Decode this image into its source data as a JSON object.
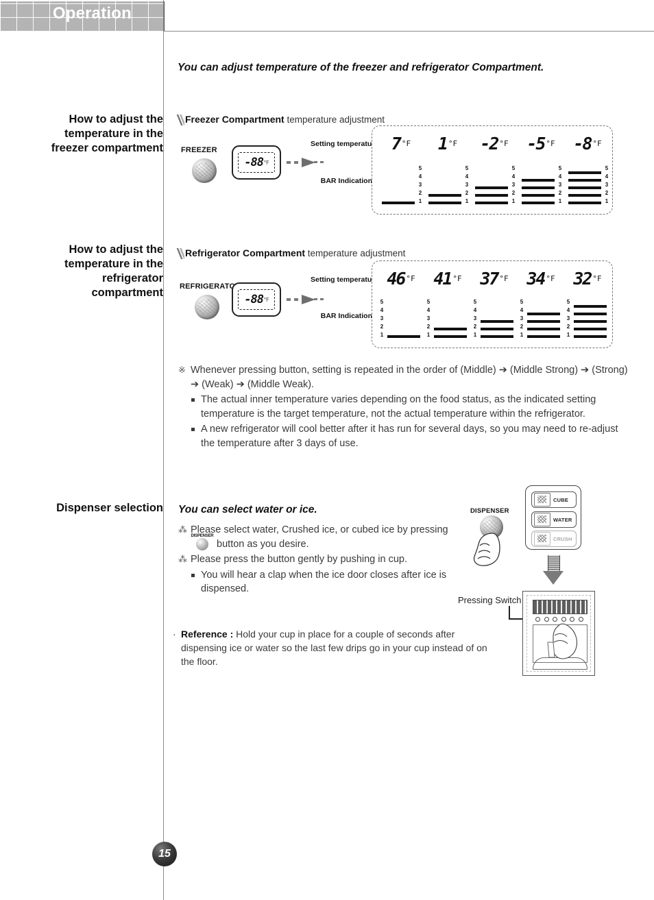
{
  "header": {
    "tab_title": "Operation"
  },
  "sidebar": {
    "headings": [
      {
        "id": "freezer",
        "text": "How to adjust the temperature in the freezer compartment"
      },
      {
        "id": "refrigerator",
        "text": "How to adjust the temperature in the refrigerator compartment"
      },
      {
        "id": "dispenser",
        "text": "Dispenser selection"
      }
    ]
  },
  "main": {
    "lead": "You can adjust temperature of the freezer and refrigerator Compartment.",
    "freezer_section": {
      "caption_bold": "Freezer Compartment",
      "caption_rest": " temperature adjustment",
      "knob_label": "FREEZER",
      "display_value": "-88",
      "display_unit": "°F",
      "label_setting": "Setting temperature",
      "label_bar": "BAR Indication"
    },
    "refrigerator_section": {
      "caption_bold": "Refrigerator Compartment",
      "caption_rest": " temperature adjustment",
      "knob_label": "REFRIGERATOR",
      "display_value": "-88",
      "display_unit": "°F",
      "label_setting": "Setting temperature",
      "label_bar": "BAR Indication"
    },
    "notes": [
      {
        "marker": "※",
        "text": "Whenever pressing button, setting is repeated in the order of (Middle) ➔ (Middle Strong) ➔  (Strong) ➔  (Weak) ➔  (Middle Weak)."
      }
    ],
    "sub_notes": [
      "The actual inner temperature varies depending on the food status, as the indicated setting temperature is the target temperature, not the actual temperature within the refrigerator.",
      "A new refrigerator will cool better after it has run for several days, so you may need to re-adjust the temperature after 3 days of use."
    ],
    "dispenser_section": {
      "title": "You can select water or ice.",
      "note1_part1": "Please select water, Crushed ice, or cubed ice by pressing",
      "note1_button_caption": "DISPENSER",
      "note1_part2": "button as you desire.",
      "note2": "Please press the button gently by pushing in cup.",
      "sub_note": "You will hear a clap when the ice door closes after ice is dispensed.",
      "reference_label": "Reference :",
      "reference_text": "Hold your cup in place for a couple of seconds after dispensing ice or water so the last few drips go in your cup instead of on the floor.",
      "illustration": {
        "dispenser_label": "DISPENSER",
        "buttons": [
          "CUBE",
          "WATER",
          "CRUSH"
        ],
        "pressing_switch_label": "Pressing Switch"
      }
    }
  },
  "chart_data": [
    {
      "type": "bar",
      "title": "Freezer Compartment temperature adjustment",
      "categories": [
        "7 °F",
        "1 °F",
        "-2 °F",
        "-5 °F",
        "-8 °F"
      ],
      "values": [
        1,
        2,
        3,
        4,
        5
      ],
      "xlabel": "Setting temperature",
      "ylabel": "BAR Indication",
      "ylim": [
        0,
        5
      ],
      "scale_labels": [
        "5",
        "4",
        "3",
        "2",
        "1"
      ],
      "scale_side": "right",
      "grid": false,
      "legend": "none"
    },
    {
      "type": "bar",
      "title": "Refrigerator Compartment temperature adjustment",
      "categories": [
        "46 °F",
        "41 °F",
        "37 °F",
        "34 °F",
        "32 °F"
      ],
      "values": [
        1,
        2,
        3,
        4,
        5
      ],
      "xlabel": "Setting temperature",
      "ylabel": "BAR Indication",
      "ylim": [
        0,
        5
      ],
      "scale_labels": [
        "5",
        "4",
        "3",
        "2",
        "1"
      ],
      "scale_side": "left",
      "grid": false,
      "legend": "none"
    }
  ],
  "footer": {
    "page_number": "15"
  }
}
